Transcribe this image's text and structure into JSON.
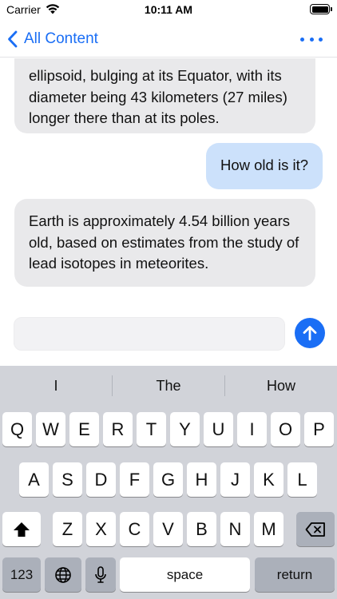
{
  "status_bar": {
    "carrier": "Carrier",
    "time": "10:11 AM"
  },
  "nav": {
    "back_label": "All Content"
  },
  "messages": [
    {
      "role": "assistant",
      "text": "ellipsoid, bulging at its Equator, with its diameter being 43 kilometers (27 miles) longer there than at its poles."
    },
    {
      "role": "user",
      "text": "How old is it?"
    },
    {
      "role": "assistant",
      "text": "Earth is approximately 4.54 billion years old, based on estimates from the study of lead isotopes in meteorites."
    }
  ],
  "input": {
    "value": "",
    "placeholder": ""
  },
  "keyboard": {
    "suggestions": [
      "I",
      "The",
      "How"
    ],
    "row1": [
      "Q",
      "W",
      "E",
      "R",
      "T",
      "Y",
      "U",
      "I",
      "O",
      "P"
    ],
    "row2": [
      "A",
      "S",
      "D",
      "F",
      "G",
      "H",
      "J",
      "K",
      "L"
    ],
    "row3": [
      "Z",
      "X",
      "C",
      "V",
      "B",
      "N",
      "M"
    ],
    "numbers_label": "123",
    "space_label": "space",
    "return_label": "return"
  },
  "colors": {
    "accent": "#1a6ef5",
    "assistant_bubble": "#e9e9eb",
    "user_bubble": "#cce1fb",
    "keyboard_bg": "#d1d3d9"
  },
  "icons": {
    "wifi": "wifi-icon",
    "battery": "battery-icon",
    "back": "chevron-left-icon",
    "more": "ellipsis-icon",
    "send": "arrow-up-icon",
    "shift": "shift-icon",
    "delete": "delete-backspace-icon",
    "globe": "globe-icon",
    "mic": "microphone-icon"
  }
}
